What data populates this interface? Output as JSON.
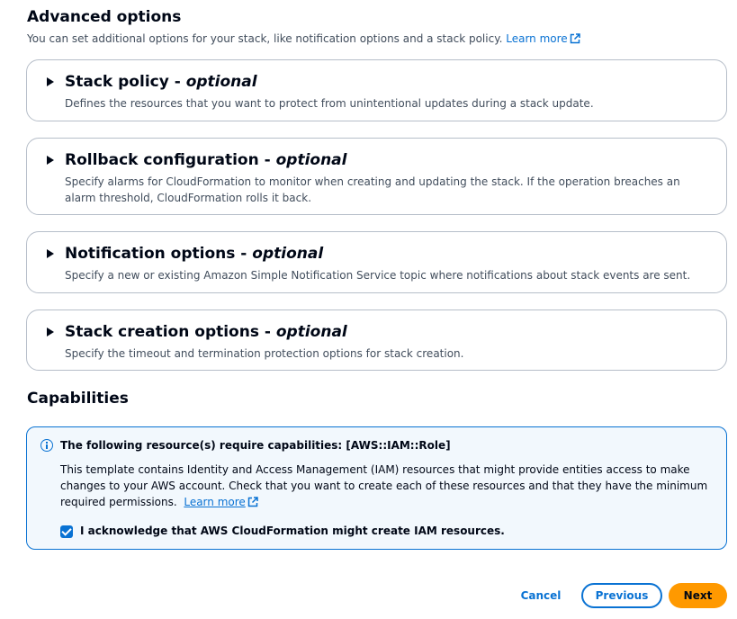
{
  "advanced": {
    "title": "Advanced options",
    "description": "You can set additional options for your stack, like notification options and a stack policy.",
    "learn_more": "Learn more"
  },
  "panels": [
    {
      "title": "Stack policy - ",
      "optional": "optional",
      "description": "Defines the resources that you want to protect from unintentional updates during a stack update."
    },
    {
      "title": "Rollback configuration - ",
      "optional": "optional",
      "description": "Specify alarms for CloudFormation to monitor when creating and updating the stack. If the operation breaches an alarm threshold, CloudFormation rolls it back."
    },
    {
      "title": "Notification options - ",
      "optional": "optional",
      "description": "Specify a new or existing Amazon Simple Notification Service topic where notifications about stack events are sent."
    },
    {
      "title": "Stack creation options - ",
      "optional": "optional",
      "description": "Specify the timeout and termination protection options for stack creation."
    }
  ],
  "capabilities": {
    "title": "Capabilities",
    "alert_title": "The following resource(s) require capabilities: [AWS::IAM::Role]",
    "alert_body": "This template contains Identity and Access Management (IAM) resources that might provide entities access to make changes to your AWS account. Check that you want to create each of these resources and that they have the minimum required permissions.",
    "learn_more": "Learn more",
    "acknowledge": "I acknowledge that AWS CloudFormation might create IAM resources.",
    "acknowledge_checked": true
  },
  "footer": {
    "cancel": "Cancel",
    "previous": "Previous",
    "next": "Next"
  },
  "colors": {
    "link": "#0972d3",
    "primary_button": "#ff9900",
    "alert_bg": "#f2f8fd"
  }
}
